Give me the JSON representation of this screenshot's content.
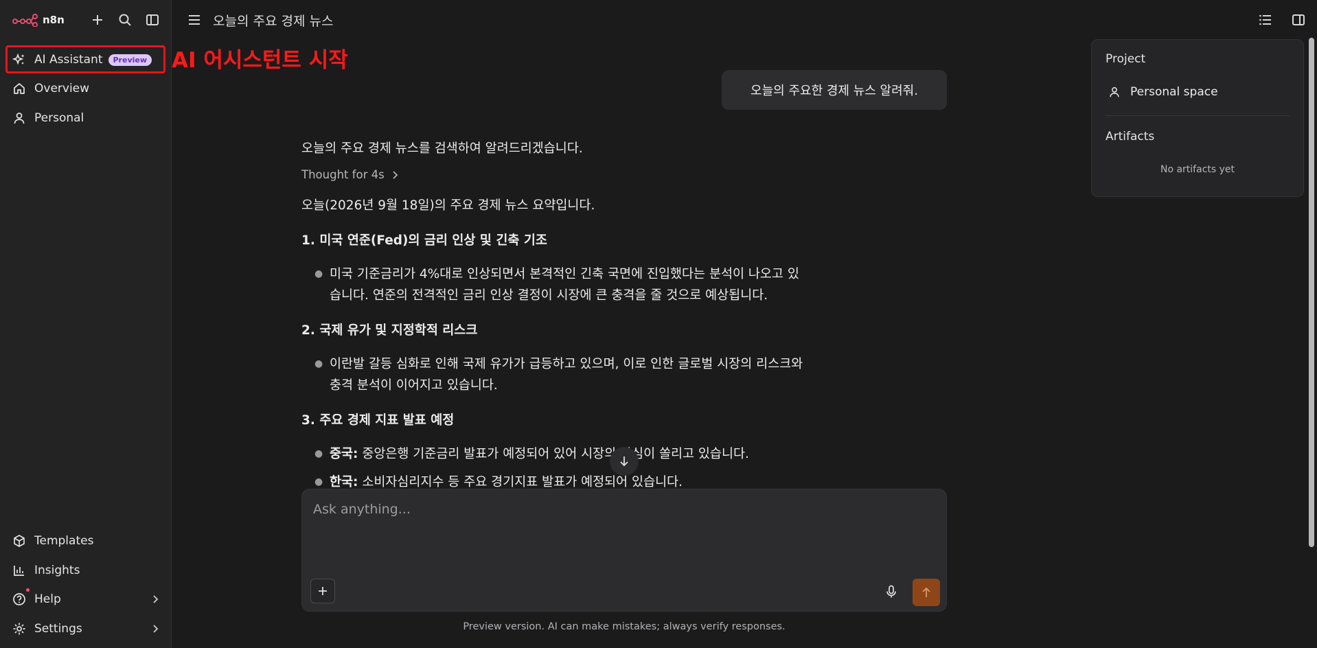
{
  "sidebar": {
    "logo_text": "n8n",
    "ai_assistant": {
      "label": "AI Assistant",
      "badge": "Preview"
    },
    "overview_label": "Overview",
    "personal_label": "Personal",
    "templates_label": "Templates",
    "insights_label": "Insights",
    "help_label": "Help",
    "settings_label": "Settings"
  },
  "annotation": "AI 어시스턴트 시작",
  "header": {
    "title": "오늘의 주요 경제 뉴스"
  },
  "right_panel": {
    "project_title": "Project",
    "space_label": "Personal space",
    "artifacts_title": "Artifacts",
    "artifacts_empty": "No artifacts yet"
  },
  "chat": {
    "user_message": "오늘의 주요한 경제 뉴스 알려줘.",
    "intro": "오늘의 주요 경제 뉴스를 검색하여 알려드리겠습니다.",
    "thought": "Thought for 4s",
    "summary": "오늘(2026년 9월 18일)의 주요 경제 뉴스 요약입니다.",
    "section1": {
      "heading": "1. 미국 연준(Fed)의 금리 인상 및 긴축 기조",
      "bullet_line1": "미국 기준금리가 4%대로 인상되면서 본격적인 긴축 국면에 진입했다는 분석이 나오고 있",
      "bullet_line2": "습니다. 연준의 전격적인 금리 인상 결정이 시장에 큰 충격을 줄 것으로 예상됩니다."
    },
    "section2": {
      "heading": "2. 국제 유가 및 지정학적 리스크",
      "bullet_line1": "이란발 갈등 심화로 인해 국제 유가가 급등하고 있으며, 이로 인한 글로벌 시장의 리스크와",
      "bullet_line2": "충격 분석이 이어지고 있습니다."
    },
    "section3": {
      "heading": "3. 주요 경제 지표 발표 예정",
      "china_label": "중국:",
      "china_text": "중앙은행 기준금리 발표가 예정되어 있어 시장의 관심이 쏠리고 있습니다.",
      "korea_label": "한국:",
      "korea_text": "소비자심리지수 등 주요 경기지표 발표가 예정되어 있습니다."
    }
  },
  "composer": {
    "placeholder": "Ask anything...",
    "footer": "Preview version. AI can make mistakes; always verify responses."
  },
  "colors": {
    "accent": "#8e4517",
    "badge_bg": "#dcc8f7",
    "badge_text": "#6b2fb8",
    "annotation": "#ff1a1a",
    "logo": "#ea4b71"
  }
}
